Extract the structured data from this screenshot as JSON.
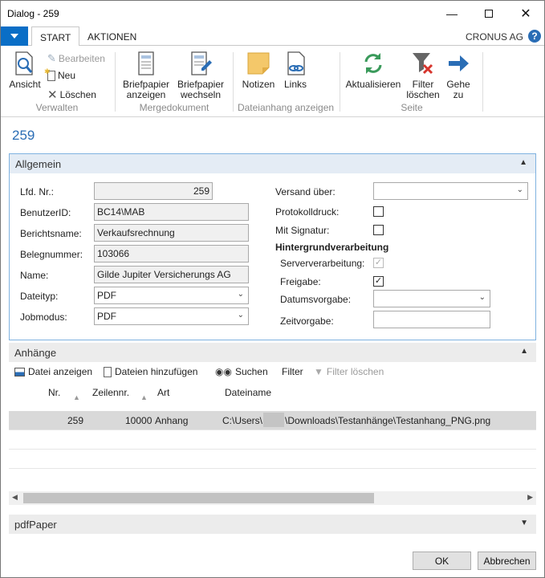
{
  "window": {
    "title": "Dialog - 259"
  },
  "ribbon_tabs": {
    "start": "START",
    "aktionen": "AKTIONEN",
    "company": "CRONUS AG",
    "help": "?"
  },
  "ribbon": {
    "verwalten": {
      "label": "Verwalten",
      "ansicht": "Ansicht",
      "bearbeiten": "Bearbeiten",
      "neu": "Neu",
      "loeschen": "Löschen"
    },
    "mergedokument": {
      "label": "Mergedokument",
      "briefpapier_anzeigen_1": "Briefpapier",
      "briefpapier_anzeigen_2": "anzeigen",
      "briefpapier_wechseln_1": "Briefpapier",
      "briefpapier_wechseln_2": "wechseln"
    },
    "dateianhang": {
      "label": "Dateianhang anzeigen",
      "notizen": "Notizen",
      "links": "Links"
    },
    "seite": {
      "label": "Seite",
      "aktualisieren": "Aktualisieren",
      "filter_1": "Filter",
      "filter_2": "löschen",
      "gehe_1": "Gehe",
      "gehe_2": "zu"
    }
  },
  "record_title": "259",
  "allgemein": {
    "title": "Allgemein",
    "lfd_nr_label": "Lfd. Nr.:",
    "lfd_nr": "259",
    "benutzerid_label": "BenutzerID:",
    "benutzerid": "BC14\\MAB",
    "berichtsname_label": "Berichtsname:",
    "berichtsname": "Verkaufsrechnung",
    "belegnummer_label": "Belegnummer:",
    "belegnummer": "103066",
    "name_label": "Name:",
    "name": "Gilde Jupiter Versicherungs AG",
    "dateityp_label": "Dateityp:",
    "dateityp": "PDF",
    "jobmodus_label": "Jobmodus:",
    "jobmodus": "PDF",
    "versand_label": "Versand über:",
    "versand": "",
    "protokolldruck_label": "Protokolldruck:",
    "protokolldruck": false,
    "signatur_label": "Mit Signatur:",
    "signatur": false,
    "hintergrund_label": "Hintergrundverarbeitung",
    "serververarbeitung_label": "Serververarbeitung:",
    "serververarbeitung": true,
    "freigabe_label": "Freigabe:",
    "freigabe": true,
    "datumsvorgabe_label": "Datumsvorgabe:",
    "datumsvorgabe": "",
    "zeitvorgabe_label": "Zeitvorgabe:",
    "zeitvorgabe": ""
  },
  "anhaenge": {
    "title": "Anhänge",
    "toolbar": {
      "datei_anzeigen": "Datei anzeigen",
      "dateien_hinzufuegen": "Dateien hinzufügen",
      "suchen": "Suchen",
      "filter": "Filter",
      "filter_loeschen": "Filter löschen"
    },
    "columns": {
      "nr": "Nr.",
      "zeilennr": "Zeilennr.",
      "art": "Art",
      "dateiname": "Dateiname"
    },
    "rows": [
      {
        "nr": "259",
        "zeilennr": "10000",
        "art": "Anhang",
        "dateiname_prefix": "C:\\Users\\",
        "dateiname_suffix": "\\Downloads\\Testanhänge\\Testanhang_PNG.png"
      }
    ]
  },
  "pdfpaper": {
    "title": "pdfPaper"
  },
  "buttons": {
    "ok": "OK",
    "abbrechen": "Abbrechen"
  },
  "colors": {
    "accent": "#2a6db5",
    "appmenu": "#0a6ec6"
  }
}
